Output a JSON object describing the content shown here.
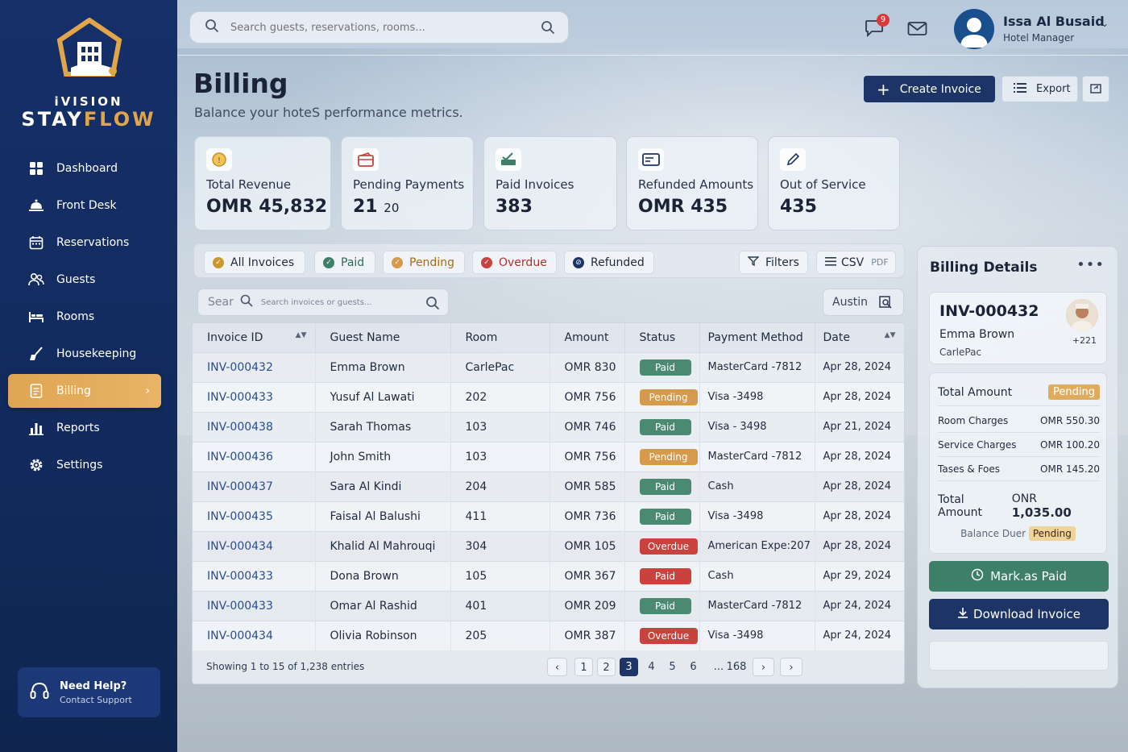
{
  "brand": {
    "top": "iVISION",
    "part1": "STAY",
    "part2": "FLOW"
  },
  "sidebar": {
    "items": [
      {
        "label": "Dashboard",
        "icon": "grid-icon"
      },
      {
        "label": "Front Desk",
        "icon": "bell-desk-icon"
      },
      {
        "label": "Reservations",
        "icon": "calendar-icon"
      },
      {
        "label": "Guests",
        "icon": "people-icon"
      },
      {
        "label": "Rooms",
        "icon": "bed-icon"
      },
      {
        "label": "Housekeeping",
        "icon": "broom-icon"
      },
      {
        "label": "Billing",
        "icon": "document-icon",
        "active": true
      },
      {
        "label": "Reports",
        "icon": "bar-chart-icon"
      },
      {
        "label": "Settings",
        "icon": "gear-icon"
      }
    ],
    "help": {
      "title": "Need Help?",
      "subtitle": "Contact Support"
    }
  },
  "topbar": {
    "search_placeholder": "Search guests, reservations, rooms...",
    "notifications_count": "9",
    "user": {
      "name": "Issa Al Busaid",
      "role": "Hotel Manager"
    }
  },
  "page": {
    "title": "Billing",
    "subtitle": "Balance your  hoteS performance metrics.",
    "create_label": "Create Invoice",
    "export_label": "Export"
  },
  "stats": [
    {
      "label": "Total Revenue",
      "value": "OMR 45,832"
    },
    {
      "label": "Pending Payments",
      "value": "21",
      "value_suffix": "20"
    },
    {
      "label": "Paid Invoices",
      "value": "383"
    },
    {
      "label": "Refunded Amounts",
      "value": "OMR 435"
    },
    {
      "label": "Out of Service",
      "value": "435"
    }
  ],
  "filters": {
    "chips": [
      "All Invoices",
      "Paid",
      "Pending",
      "Overdue",
      "Refunded"
    ],
    "filters_label": "Filters",
    "csv_label": "CSV",
    "pdf_label": "PDF"
  },
  "table_search": {
    "prefix": "Sear",
    "placeholder": "Search invoices or guests..."
  },
  "location_filter": "Austin",
  "table": {
    "headers": [
      "Invoice ID",
      "Guest Name",
      "Room",
      "Amount",
      "Status",
      "Payment Method",
      "Date"
    ],
    "rows": [
      {
        "id": "INV-000432",
        "guest": "Emma Brown",
        "room": "CarlePac",
        "amount": "OMR 830",
        "status": "Paid",
        "status_kind": "paid",
        "method": "MasterCard  -7812",
        "date": "Apr 28, 2024"
      },
      {
        "id": "INV-000433",
        "guest": "Yusuf Al Lawati",
        "room": "202",
        "amount": "OMR 756",
        "status": "Pending",
        "status_kind": "pending",
        "method": "Visa  -3498",
        "date": "Apr 28, 2024"
      },
      {
        "id": "INV-000438",
        "guest": "Sarah Thomas",
        "room": "103",
        "amount": "OMR 746",
        "status": "Paid",
        "status_kind": "paid",
        "method": "Visa  - 3498",
        "date": "Apr 21, 2024"
      },
      {
        "id": "INV-000436",
        "guest": "John Smith",
        "room": "103",
        "amount": "OMR 756",
        "status": "Pending",
        "status_kind": "pending",
        "method": "MasterCard  -7812",
        "date": "Apr 28, 2024"
      },
      {
        "id": "INV-000437",
        "guest": "Sara Al Kindi",
        "room": "204",
        "amount": "OMR 585",
        "status": "Paid",
        "status_kind": "paid",
        "method": "Cash",
        "date": "Apr 28, 2024"
      },
      {
        "id": "INV-000435",
        "guest": "Faisal Al Balushi",
        "room": "411",
        "amount": "OMR 736",
        "status": "Paid",
        "status_kind": "paid",
        "method": "Visa  -3498",
        "date": "Apr 28, 2024"
      },
      {
        "id": "INV-000434",
        "guest": "Khalid Al Mahrouqi",
        "room": "304",
        "amount": "OMR 105",
        "status": "Overdue",
        "status_kind": "overdue",
        "method": "American Expe:207",
        "date": "Apr 28, 2024"
      },
      {
        "id": "INV-000433",
        "guest": "Dona Brown",
        "room": "105",
        "amount": "OMR 367",
        "status": "Paid",
        "status_kind": "paidred",
        "method": "Cash",
        "date": "Apr 29, 2024"
      },
      {
        "id": "INV-000433",
        "guest": "Omar Al Rashid",
        "room": "401",
        "amount": "OMR 209",
        "status": "Paid",
        "status_kind": "paid",
        "method": "MasterCard  -7812",
        "date": "Apr 24, 2024"
      },
      {
        "id": "INV-000434",
        "guest": "Olivia Robinson",
        "room": "205",
        "amount": "OMR 387",
        "status": "Overdue",
        "status_kind": "overdue",
        "method": "Visa  -3498",
        "date": "Apr 24, 2024"
      }
    ],
    "footer": "Showing 1 to 15 of 1,238 entries",
    "pages": [
      "1",
      "2",
      "3",
      "4",
      "5",
      "6",
      "...",
      "168"
    ],
    "active_page": "3"
  },
  "details": {
    "title": "Billing Details",
    "invoice_no": "INV-000432",
    "guest": "Emma Brown",
    "room": "CarlePac",
    "extra": "+221",
    "total_label": "Total Amount",
    "total_status": "Pending",
    "lines": [
      {
        "label": "Room Charges",
        "value": "OMR 550.30"
      },
      {
        "label": "Service Charges",
        "value": "OMR 100.20"
      },
      {
        "label": "Tases & Foes",
        "value": "OMR 145.20"
      }
    ],
    "grand_label": "Total Amount",
    "grand_prefix": "ONR",
    "grand_value": "1,035.00",
    "balance_label": "Balance Duer",
    "balance_status": "Pending",
    "mark_paid_label": "Mark.as Paid",
    "download_label": "Download Invoice"
  },
  "colors": {
    "navy": "#1c3566",
    "gold": "#e2a64a",
    "green": "#3d7f69",
    "red": "#c9423e"
  }
}
